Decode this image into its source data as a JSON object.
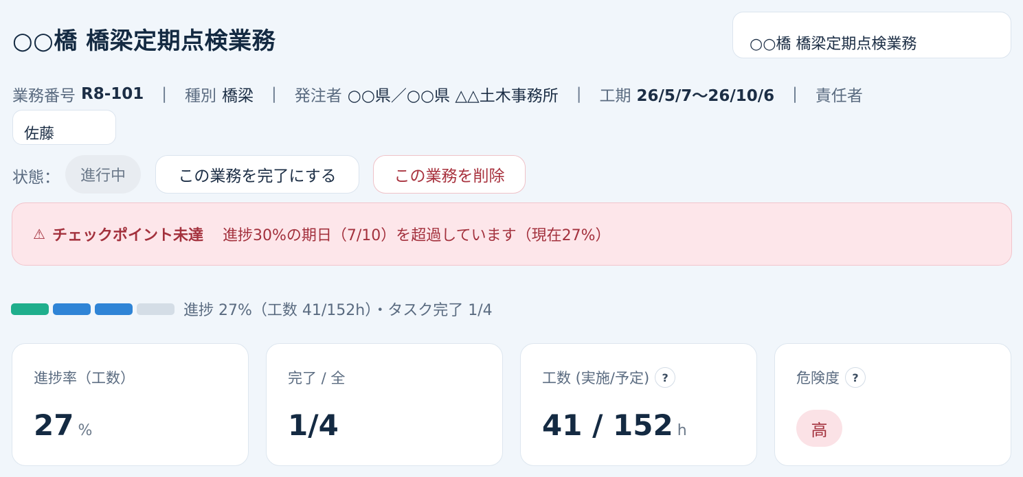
{
  "header": {
    "title": "○○橋 橋梁定期点検業務",
    "title_input_value": "○○橋 橋梁定期点検業務"
  },
  "meta": {
    "number_label": "業務番号",
    "number_value": "R8-101",
    "type_label": "種別",
    "type_value": "橋梁",
    "client_label": "発注者",
    "client_value": "○○県／○○県 △△土木事務所",
    "period_label": "工期",
    "period_value": "26/5/7〜26/10/6",
    "owner_label": "責任者",
    "owner_value": "佐藤",
    "separator": "|"
  },
  "status": {
    "label": "状態：",
    "value": "進行中",
    "complete_button": "この業務を完了にする",
    "delete_button": "この業務を削除"
  },
  "alert": {
    "icon": "warning-icon",
    "icon_glyph": "⚠",
    "heading": "チェックポイント未達",
    "message": "進捗30%の期日（7/10）を超過しています（現在27%）"
  },
  "progress": {
    "fraction": 0.27,
    "segments": [
      {
        "state": "done",
        "color": "#1fae8c"
      },
      {
        "state": "in-progress",
        "color": "#2f84d6"
      },
      {
        "state": "in-progress",
        "color": "#2f84d6"
      },
      {
        "state": "pending",
        "color": "#d4dde6"
      }
    ],
    "text": "進捗 27%（工数 41/152h）・タスク完了 1/4"
  },
  "cards": {
    "progress_rate": {
      "label": "進捗率（工数）",
      "value": "27",
      "unit": "%"
    },
    "completion": {
      "label": "完了 / 全",
      "value": "1/4"
    },
    "man_hours": {
      "label": "工数 (実施/予定)",
      "value": "41 / 152",
      "unit": "h",
      "help": "?"
    },
    "risk": {
      "label": "危険度",
      "value": "高",
      "help": "?"
    }
  },
  "colors": {
    "accent_green": "#1fae8c",
    "accent_blue": "#2f84d6",
    "danger": "#a3313d",
    "alert_bg": "#fde6ea"
  }
}
